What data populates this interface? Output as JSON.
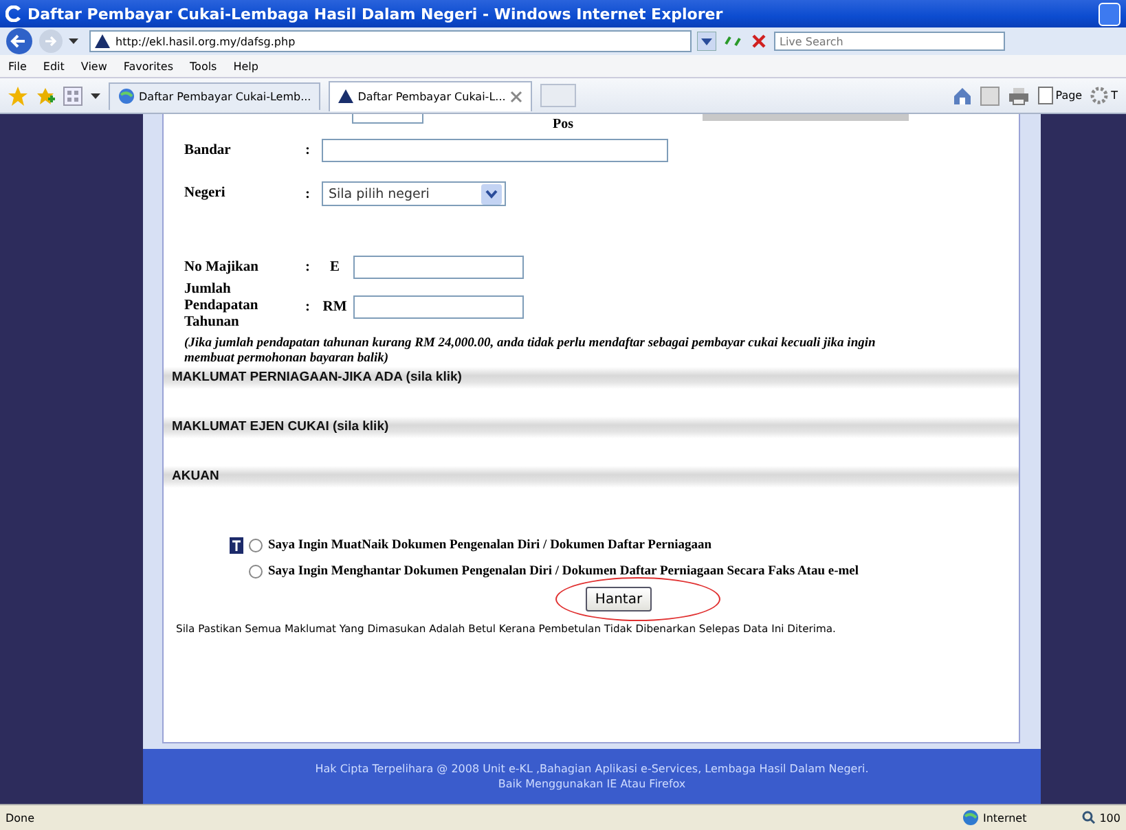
{
  "window": {
    "title": "Daftar Pembayar Cukai-Lembaga Hasil Dalam Negeri - Windows Internet Explorer"
  },
  "address_bar": {
    "url": "http://ekl.hasil.org.my/dafsg.php",
    "search_placeholder": "Live Search"
  },
  "menu": [
    "File",
    "Edit",
    "View",
    "Favorites",
    "Tools",
    "Help"
  ],
  "tabs": [
    {
      "label": "Daftar Pembayar Cukai-Lemb...",
      "selected": false
    },
    {
      "label": "Daftar Pembayar Cukai-L...",
      "selected": true
    }
  ],
  "command_bar": [
    "Page",
    "T"
  ],
  "form": {
    "partial_label": "Pos",
    "fields": [
      {
        "kind": "text",
        "label": "Bandar",
        "separator": ":"
      },
      {
        "kind": "select",
        "label": "Negeri",
        "separator": ":",
        "value": "Sila pilih negeri"
      },
      {
        "kind": "text",
        "label": "No Majikan",
        "separator": ":",
        "prefix": "E"
      },
      {
        "kind": "text",
        "label": "Jumlah Pendapatan Tahunan",
        "separator": ":",
        "prefix": "RM"
      }
    ],
    "note": "(Jika jumlah pendapatan tahunan kurang RM 24,000.00, anda tidak perlu mendaftar sebagai pembayar cukai kecuali jika ingin membuat permohonan bayaran balik)",
    "sections": [
      "MAKLUMAT PERNIAGAAN-JIKA ADA (sila klik)",
      "MAKLUMAT EJEN CUKAI (sila klik)",
      "AKUAN"
    ],
    "options": [
      {
        "label": "Saya Ingin MuatNaik Dokumen Pengenalan Diri / Dokumen Daftar Perniagaan",
        "selected": false
      },
      {
        "label": "Saya Ingin Menghantar Dokumen Pengenalan Diri / Dokumen Daftar Perniagaan Secara Faks Atau e-mel",
        "selected": false
      }
    ],
    "submit": "Hantar",
    "warning": "Sila Pastikan Semua Maklumat Yang Dimasukan Adalah Betul Kerana Pembetulan Tidak Dibenarkan Selepas Data Ini Diterima."
  },
  "footer": [
    "Hak Cipta Terpelihara @ 2008 Unit e-KL ,Bahagian Aplikasi e-Services, Lembaga Hasil Dalam Negeri.",
    "Baik Menggunakan IE Atau Firefox"
  ],
  "status_bar": {
    "text": "Done",
    "zone": "Internet",
    "zoom": "100"
  }
}
